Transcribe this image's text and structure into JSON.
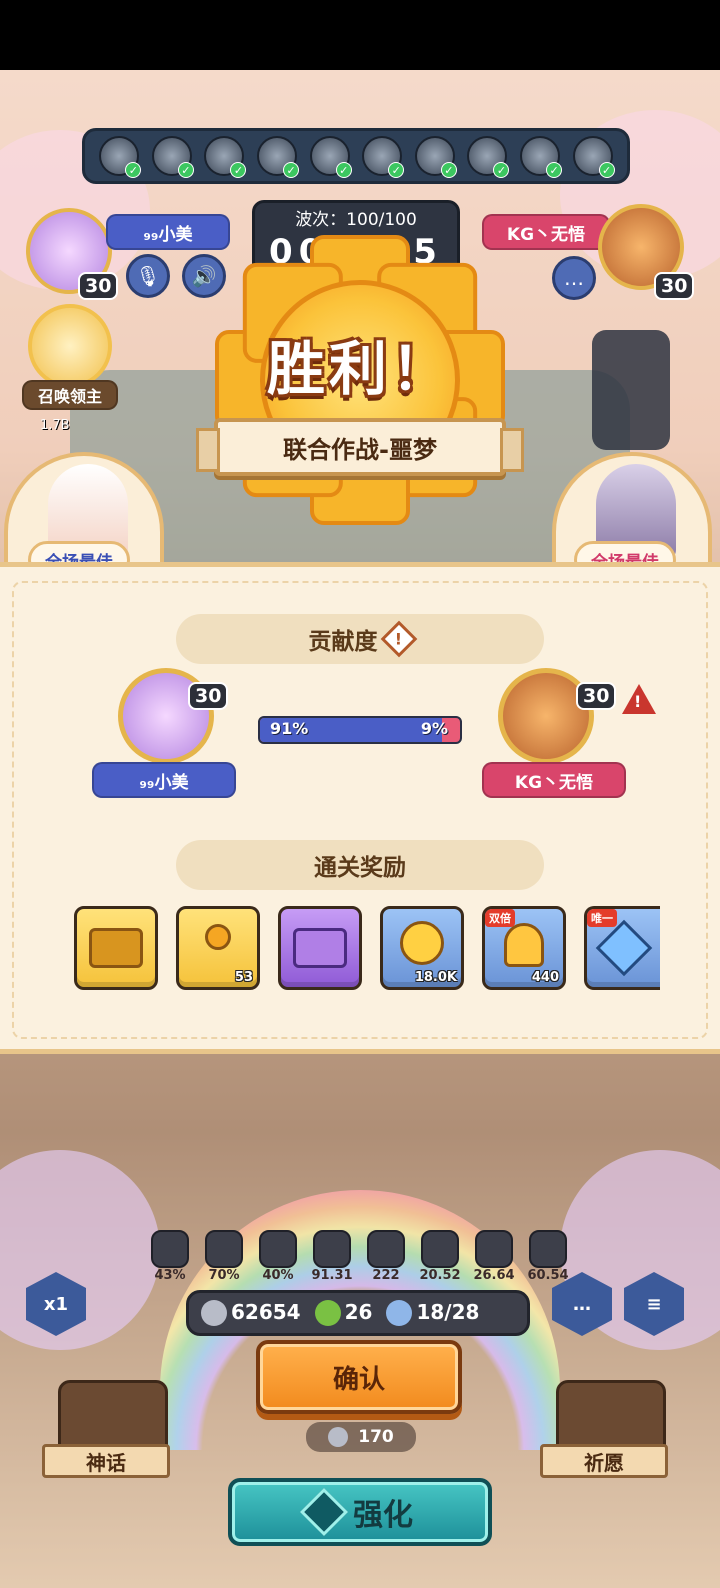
{
  "top_hud": {
    "wave_label": "波次：100/100",
    "timer": "00 : 25",
    "player_left_name": "₉₉小美",
    "player_left_level": "30",
    "player_right_name": "KG丶无悟",
    "player_right_level": "30",
    "summon_label": "召唤领主",
    "summon_value": "1.7B"
  },
  "victory": {
    "title": "胜利！",
    "stage": "联合作战-噩梦"
  },
  "best": {
    "left_label": "全场最佳",
    "right_label": "全场最佳"
  },
  "contribution": {
    "title": "贡献度",
    "left_name": "₉₉小美",
    "left_level": "30",
    "left_percent": "91%",
    "left_fraction": 0.91,
    "right_name": "KG丶无悟",
    "right_level": "30",
    "right_percent": "9%"
  },
  "rewards": {
    "title": "通关奖励",
    "items": [
      {
        "name": "gold-chest",
        "qty": "",
        "tag": ""
      },
      {
        "name": "golden-key",
        "qty": "53",
        "tag": ""
      },
      {
        "name": "purple-chest",
        "qty": "",
        "tag": ""
      },
      {
        "name": "gold-coin",
        "qty": "18.0K",
        "tag": ""
      },
      {
        "name": "trophy",
        "qty": "440",
        "tag": "双倍"
      },
      {
        "name": "blue-crystal",
        "qty": "",
        "tag": "唯一"
      }
    ]
  },
  "stats": [
    "43%",
    "70%",
    "40%",
    "91.31",
    "222",
    "20.52",
    "26.64",
    "60.54"
  ],
  "resources": {
    "silver": "62654",
    "clover": "26",
    "units": "18/28"
  },
  "speed_label": "x1",
  "confirm_label": "确认",
  "cost_value": "170",
  "left_side_label": "神话",
  "right_side_label": "祈愿",
  "upgrade_label": "强化",
  "colors": {
    "blue_plate": "#4a5ec6",
    "pink_plate": "#d9456b",
    "panel_bg": "#fbf1df",
    "accent_orange": "#f28a1d"
  }
}
